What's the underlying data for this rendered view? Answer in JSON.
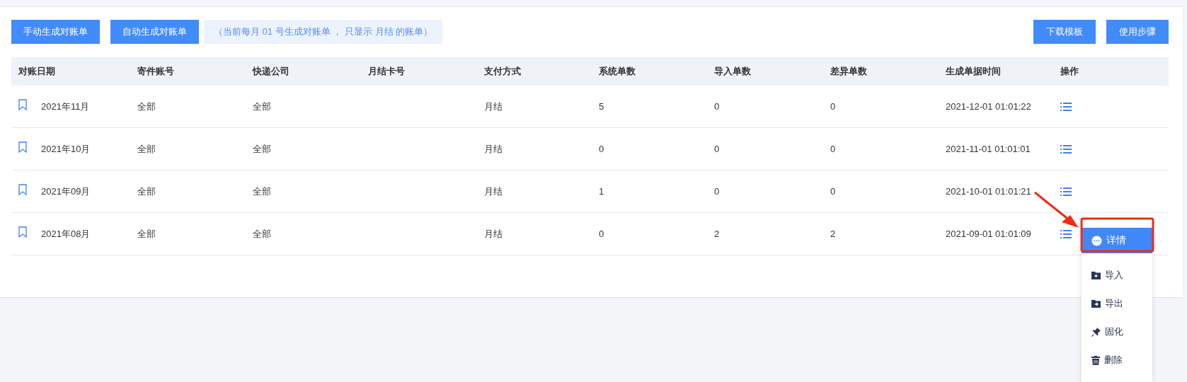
{
  "toolbar": {
    "buttons": [
      "手动生成对账单",
      "自动生成对账单"
    ],
    "note": "（当前每月 01 号生成对账单 ， 只显示 月结 的账单）",
    "right_buttons": [
      "下载模板",
      "使用步骤"
    ]
  },
  "table": {
    "columns": [
      "对账日期",
      "寄件账号",
      "快递公司",
      "月结卡号",
      "支付方式",
      "系统单数",
      "导入单数",
      "差异单数",
      "生成单据时间",
      "操作"
    ],
    "rows": [
      {
        "period": "2021年11月",
        "account": "全部",
        "company": "全部",
        "card": "",
        "payment": "月结",
        "system_count": "5",
        "import_count": "0",
        "diff_count": "0",
        "created": "2021-12-01 01:01:22"
      },
      {
        "period": "2021年10月",
        "account": "全部",
        "company": "全部",
        "card": "",
        "payment": "月结",
        "system_count": "0",
        "import_count": "0",
        "diff_count": "0",
        "created": "2021-11-01 01:01:01"
      },
      {
        "period": "2021年09月",
        "account": "全部",
        "company": "全部",
        "card": "",
        "payment": "月结",
        "system_count": "1",
        "import_count": "0",
        "diff_count": "0",
        "created": "2021-10-01 01:01:21"
      },
      {
        "period": "2021年08月",
        "account": "全部",
        "company": "全部",
        "card": "",
        "payment": "月结",
        "system_count": "0",
        "import_count": "2",
        "diff_count": "2",
        "created": "2021-09-01 01:01:09"
      }
    ]
  },
  "action_menu": {
    "items": [
      {
        "kind": "details",
        "label": "详情",
        "selected": true
      },
      {
        "kind": "import",
        "label": "导入",
        "selected": false
      },
      {
        "kind": "export",
        "label": "导出",
        "selected": false
      },
      {
        "kind": "pin",
        "label": "固化",
        "selected": false
      },
      {
        "kind": "delete",
        "label": "删除",
        "selected": false
      }
    ]
  }
}
